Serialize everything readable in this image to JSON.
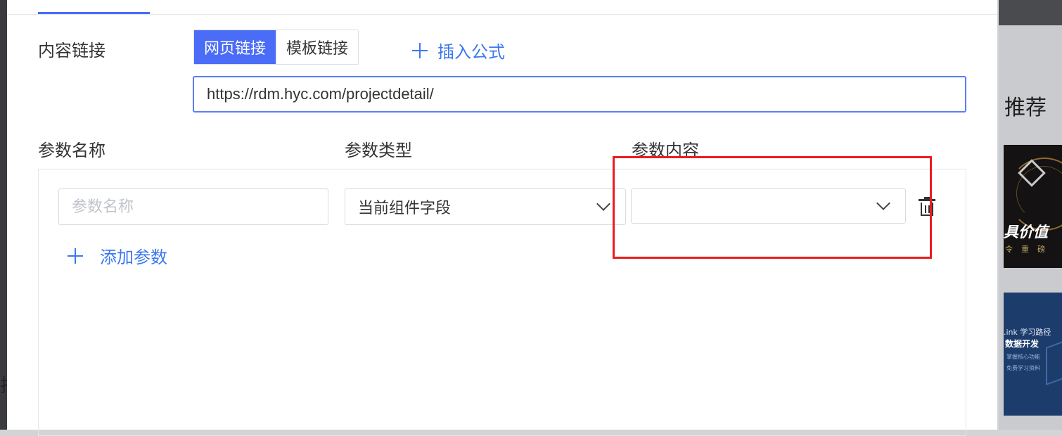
{
  "background": {
    "right_text": "推荐",
    "left_partial_char": "排",
    "banner_dark": {
      "headline": "具价值",
      "subline": "令重磅"
    },
    "banner_blue": {
      "line1": ".ink 学习路径",
      "line2": "数据开发",
      "line3": "掌握核心功能",
      "line4": "免费学习资料"
    }
  },
  "content_link": {
    "label": "内容链接",
    "tabs": [
      {
        "label": "网页链接",
        "active": true
      },
      {
        "label": "模板链接",
        "active": false
      }
    ],
    "insert_formula_label": "插入公式",
    "url_value": "https://rdm.hyc.com/projectdetail/"
  },
  "params": {
    "headers": {
      "name": "参数名称",
      "type": "参数类型",
      "content": "参数内容"
    },
    "row": {
      "name_placeholder": "参数名称",
      "name_value": "",
      "type_value": "当前组件字段",
      "content_value": ""
    },
    "add_label": "添加参数"
  },
  "colors": {
    "primary": "#4a6cf7",
    "link": "#3c78ef",
    "highlight": "#ee1c1c"
  }
}
